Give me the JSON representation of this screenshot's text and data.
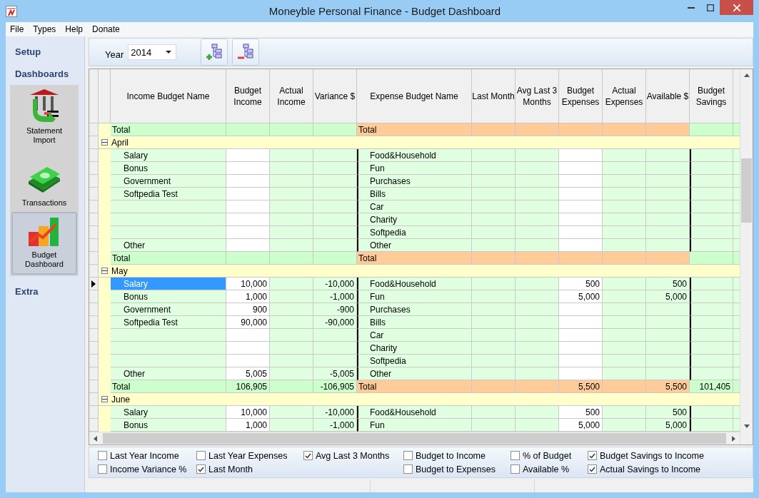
{
  "window": {
    "title": "Moneyble Personal Finance - Budget Dashboard"
  },
  "menu": [
    "File",
    "Types",
    "Help",
    "Donate"
  ],
  "sidebar": {
    "sections": [
      {
        "title": "Setup"
      },
      {
        "title": "Dashboards",
        "items": [
          {
            "label": "Statement Import",
            "selected": false
          },
          {
            "label": "Transactions",
            "selected": false
          },
          {
            "label": "Budget Dashboard",
            "selected": true
          }
        ]
      },
      {
        "title": "Extra"
      }
    ]
  },
  "toolbar": {
    "year_label": "Year",
    "year": "2014"
  },
  "grid": {
    "columns": [
      "Income Budget Name",
      "Budget Income",
      "Actual Income",
      "Variance $",
      "Expense Budget Name",
      "Last Month",
      "Avg Last 3 Months",
      "Budget Expenses",
      "Actual Expenses",
      "Available $",
      "Budget Savings"
    ],
    "total": {
      "income_name": "Total",
      "expense_name": "Total"
    },
    "groups": [
      {
        "name": "April",
        "expanded": true,
        "rows": [
          {
            "income_name": "Salary",
            "expense_name": "Food&Household",
            "selected": false
          },
          {
            "income_name": "Bonus",
            "expense_name": "Fun",
            "selected": false
          },
          {
            "income_name": "Government",
            "expense_name": "Purchases",
            "selected": false
          },
          {
            "income_name": "Softpedia Test",
            "expense_name": "Bills",
            "selected": false
          },
          {
            "expense_name": "Car",
            "selected": false
          },
          {
            "expense_name": "Charity",
            "selected": false
          },
          {
            "expense_name": "Softpedia",
            "selected": false
          },
          {
            "income_name": "Other",
            "expense_name": "Other",
            "selected": false
          }
        ],
        "total": {
          "income_name": "Total",
          "expense_name": "Total"
        }
      },
      {
        "name": "May",
        "expanded": true,
        "rows": [
          {
            "income_name": "Salary",
            "budget_income": "10,000",
            "variance": "-10,000",
            "expense_name": "Food&Household",
            "budget_expenses": "500",
            "available": "500",
            "selected": true
          },
          {
            "income_name": "Bonus",
            "budget_income": "1,000",
            "variance": "-1,000",
            "expense_name": "Fun",
            "budget_expenses": "5,000",
            "available": "5,000",
            "selected": false
          },
          {
            "income_name": "Government",
            "budget_income": "900",
            "variance": "-900",
            "expense_name": "Purchases",
            "selected": false
          },
          {
            "income_name": "Softpedia Test",
            "budget_income": "90,000",
            "variance": "-90,000",
            "expense_name": "Bills",
            "selected": false
          },
          {
            "expense_name": "Car",
            "selected": false
          },
          {
            "expense_name": "Charity",
            "selected": false
          },
          {
            "expense_name": "Softpedia",
            "selected": false
          },
          {
            "income_name": "Other",
            "budget_income": "5,005",
            "variance": "-5,005",
            "expense_name": "Other",
            "selected": false
          }
        ],
        "total": {
          "income_name": "Total",
          "budget_income": "106,905",
          "variance": "-106,905",
          "expense_name": "Total",
          "budget_expenses": "5,500",
          "available": "5,500",
          "budget_savings": "101,405"
        }
      },
      {
        "name": "June",
        "expanded": true,
        "rows": [
          {
            "income_name": "Salary",
            "budget_income": "10,000",
            "variance": "-10,000",
            "expense_name": "Food&Household",
            "budget_expenses": "500",
            "available": "500",
            "selected": false
          },
          {
            "income_name": "Bonus",
            "budget_income": "1,000",
            "variance": "-1,000",
            "expense_name": "Fun",
            "budget_expenses": "5,000",
            "available": "5,000",
            "selected": false
          }
        ]
      }
    ]
  },
  "option_columns": [
    [
      {
        "label": "Last Year Income",
        "checked": false
      },
      {
        "label": "Income Variance %",
        "checked": false
      }
    ],
    [
      {
        "label": "Last Year Expenses",
        "checked": false
      },
      {
        "label": "Last Month",
        "checked": true
      }
    ],
    [
      {
        "label": "Avg Last 3 Months",
        "checked": true
      }
    ],
    [
      {
        "label": "Budget to Income",
        "checked": false
      },
      {
        "label": "Budget to Expenses",
        "checked": false
      }
    ],
    [
      {
        "label": "% of Budget",
        "checked": false
      },
      {
        "label": "Available %",
        "checked": false
      }
    ],
    [
      {
        "label": "Budget Savings to Income",
        "checked": true
      },
      {
        "label": "Actual Savings to Income",
        "checked": true
      }
    ]
  ]
}
